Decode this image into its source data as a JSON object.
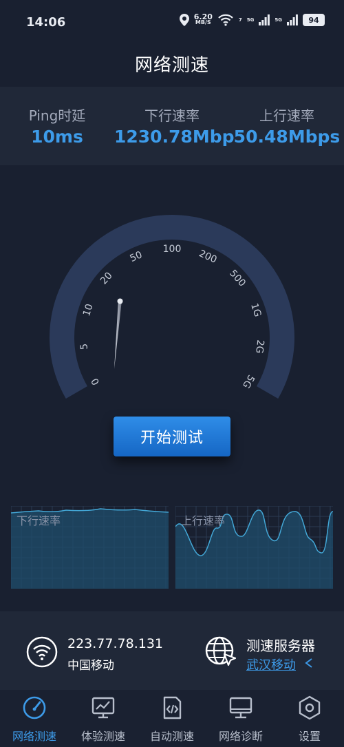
{
  "status_bar": {
    "time": "14:06",
    "net_speed_value": "6.20",
    "net_speed_unit": "MB/S",
    "wifi_tag": "7",
    "signal1_tag": "5G",
    "signal2_tag": "5G",
    "battery": "94",
    "icons": [
      "location-icon",
      "wifi-icon",
      "signal-icon",
      "battery-icon"
    ]
  },
  "header": {
    "title": "网络测速"
  },
  "stats": {
    "ping": {
      "label": "Ping时延",
      "value": "10ms"
    },
    "download": {
      "label": "下行速率",
      "value": "1230.78Mbp"
    },
    "upload": {
      "label": "上行速率",
      "value": "50.48Mbps"
    }
  },
  "gauge": {
    "ticks": [
      "0",
      "5",
      "10",
      "20",
      "50",
      "100",
      "200",
      "500",
      "1G",
      "2G",
      "5G"
    ],
    "needle_tick_fraction": 0.27
  },
  "start_button": {
    "label": "开始测试"
  },
  "graphs": {
    "download_label": "下行速率",
    "upload_label": "上行速率"
  },
  "network_info": {
    "ip": "223.77.78.131",
    "isp": "中国移动",
    "server_title": "测速服务器",
    "server_name": "武汉移动"
  },
  "colors": {
    "background": "#192030",
    "panel": "#202838",
    "accent": "#3d9be9",
    "gauge_ring": "#2b3a5a"
  },
  "nav": {
    "items": [
      {
        "label": "网络测速",
        "icon": "speedometer-icon",
        "active": true
      },
      {
        "label": "体验测速",
        "icon": "monitor-chart-icon",
        "active": false
      },
      {
        "label": "自动测速",
        "icon": "code-file-icon",
        "active": false
      },
      {
        "label": "网络诊断",
        "icon": "desktop-icon",
        "active": false
      },
      {
        "label": "设置",
        "icon": "settings-hexagon-icon",
        "active": false
      }
    ]
  }
}
